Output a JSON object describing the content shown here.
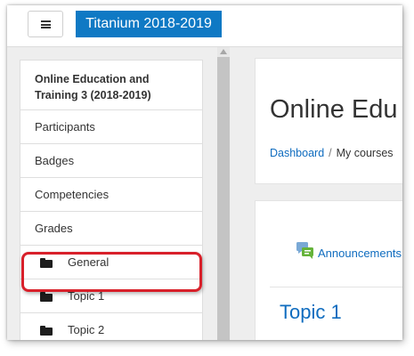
{
  "header": {
    "menu_button_label": "Toggle navigation",
    "site_title": "Titanium 2018-2019"
  },
  "drawer": {
    "course_title": "Online Education and Training 3 (2018-2019)",
    "items": [
      {
        "label": "Participants"
      },
      {
        "label": "Badges"
      },
      {
        "label": "Competencies"
      },
      {
        "label": "Grades"
      }
    ],
    "sections": [
      {
        "label": "General",
        "icon": "folder-icon"
      },
      {
        "label": "Topic 1",
        "icon": "folder-icon"
      },
      {
        "label": "Topic 2",
        "icon": "folder-icon"
      }
    ]
  },
  "main": {
    "page_heading": "Online Edu",
    "breadcrumb": [
      "Dashboard",
      "My courses"
    ],
    "breadcrumb_separator": "/",
    "announcements_label": "Announcements",
    "section_heading": "Topic 1"
  },
  "annotation": {
    "highlight_color": "#d8202a",
    "highlighted_item": "Grades"
  },
  "colors": {
    "brand": "#0f79c4",
    "link": "#0f6cbf"
  }
}
